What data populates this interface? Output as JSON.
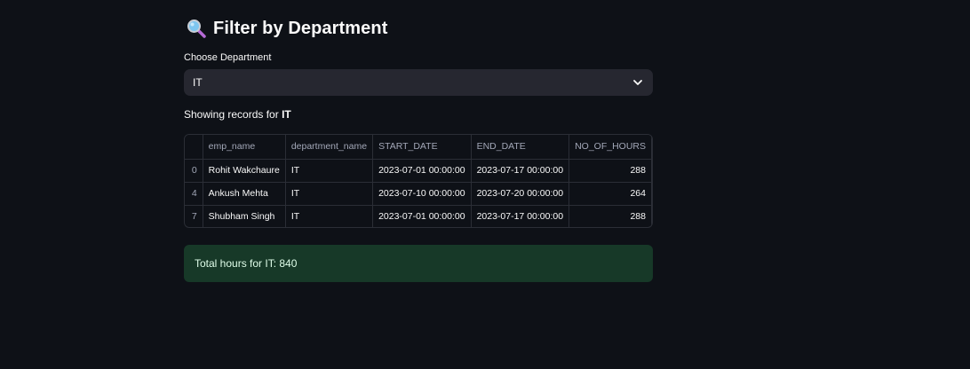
{
  "header": {
    "title": "Filter by Department",
    "icon": "magnifying-glass-icon"
  },
  "department_select": {
    "label": "Choose Department",
    "selected": "IT"
  },
  "showing": {
    "prefix": "Showing records for ",
    "department": "IT"
  },
  "table": {
    "columns": [
      "",
      "emp_name",
      "department_name",
      "START_DATE",
      "END_DATE",
      "NO_OF_HOURS"
    ],
    "rows": [
      {
        "index": "0",
        "emp_name": "Rohit Wakchaure",
        "department_name": "IT",
        "start_date": "2023-07-01 00:00:00",
        "end_date": "2023-07-17 00:00:00",
        "hours": "288"
      },
      {
        "index": "4",
        "emp_name": "Ankush Mehta",
        "department_name": "IT",
        "start_date": "2023-07-10 00:00:00",
        "end_date": "2023-07-20 00:00:00",
        "hours": "264"
      },
      {
        "index": "7",
        "emp_name": "Shubham Singh",
        "department_name": "IT",
        "start_date": "2023-07-01 00:00:00",
        "end_date": "2023-07-17 00:00:00",
        "hours": "288"
      }
    ]
  },
  "total": {
    "text": "Total hours for IT: 840"
  },
  "colors": {
    "background": "#0e1117",
    "select_bg": "#262730",
    "success_bg": "#173928",
    "success_text": "#dffde9"
  }
}
